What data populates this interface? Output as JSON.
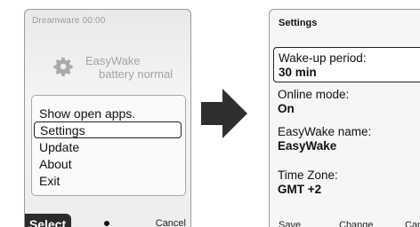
{
  "left_screen": {
    "header": "Dreamware 00:00",
    "app": {
      "name": "EasyWake",
      "status": "battery normal"
    },
    "menu": [
      {
        "label": "Show open apps.",
        "selected": false
      },
      {
        "label": "Settings",
        "selected": true
      },
      {
        "label": "Update",
        "selected": false
      },
      {
        "label": "About",
        "selected": false
      },
      {
        "label": "Exit",
        "selected": false
      }
    ],
    "softkeys": {
      "left": "Select",
      "right": "Cancel"
    }
  },
  "right_screen": {
    "title": "Settings",
    "fields": [
      {
        "label": "Wake-up period:",
        "value": "30 min",
        "selected": true
      },
      {
        "label": "Online mode:",
        "value": "On",
        "selected": false
      },
      {
        "label": "EasyWake name:",
        "value": "EasyWake",
        "selected": false
      },
      {
        "label": "Time Zone:",
        "value": "GMT +2",
        "selected": false
      }
    ],
    "softkeys": {
      "left": "Save",
      "center": "Change",
      "right": "Cancel"
    }
  },
  "icons": {
    "app_icon": "gear-icon",
    "transition": "arrow-right-icon",
    "center_softkey": "dot-icon"
  },
  "colors": {
    "softkey_bg": "#2b2b2b",
    "arrow": "#2f2f2f"
  }
}
